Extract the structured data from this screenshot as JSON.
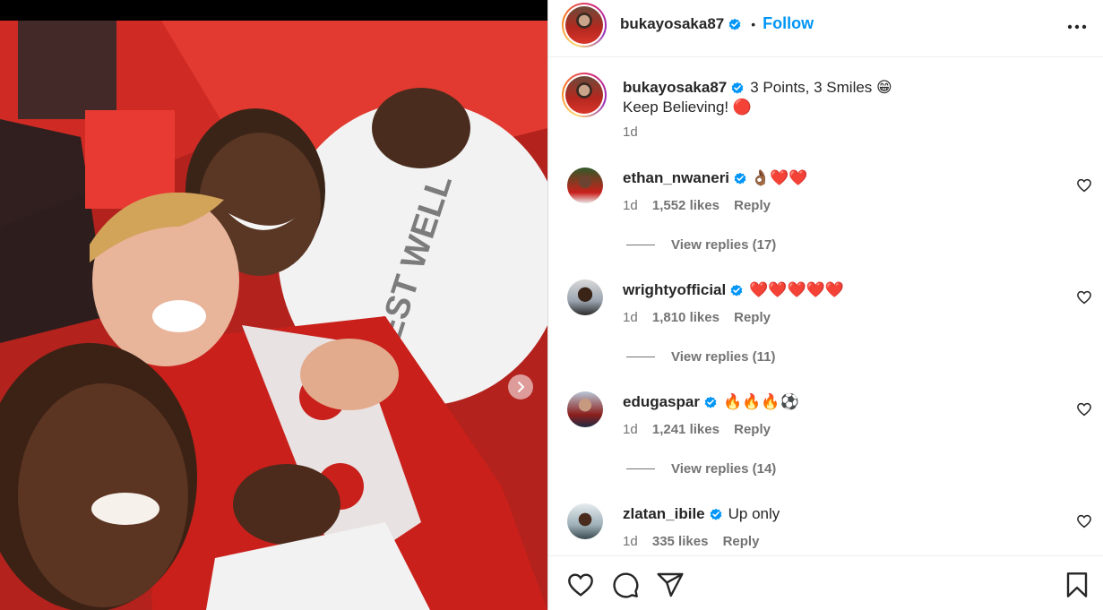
{
  "post": {
    "author": "bukayosaka87",
    "follow_label": "Follow",
    "separator": "•",
    "caption_line1": "3 Points, 3 Smiles 😁",
    "caption_line2": "Keep Believing! 🔴",
    "time": "1d"
  },
  "comments": [
    {
      "user": "ethan_nwaneri",
      "text": "👌🏾❤️❤️",
      "time": "1d",
      "likes": "1,552 likes",
      "reply": "Reply",
      "view_replies": "View replies (17)"
    },
    {
      "user": "wrightyofficial",
      "text": "❤️❤️❤️❤️❤️",
      "time": "1d",
      "likes": "1,810 likes",
      "reply": "Reply",
      "view_replies": "View replies (11)"
    },
    {
      "user": "edugaspar",
      "text": "🔥🔥🔥⚽",
      "time": "1d",
      "likes": "1,241 likes",
      "reply": "Reply",
      "view_replies": "View replies (14)"
    },
    {
      "user": "zlatan_ibile",
      "text": "Up only",
      "time": "1d",
      "likes": "335 likes",
      "reply": "Reply"
    }
  ],
  "icons": {
    "verified": "verified-badge-icon",
    "more": "more-options-icon",
    "like": "heart-icon",
    "comment": "comment-icon",
    "share": "share-icon",
    "save": "bookmark-icon",
    "next": "chevron-right-icon"
  },
  "colors": {
    "accent": "#0095f6",
    "verified": "#0095f6",
    "muted": "#737373",
    "text": "#262626"
  }
}
